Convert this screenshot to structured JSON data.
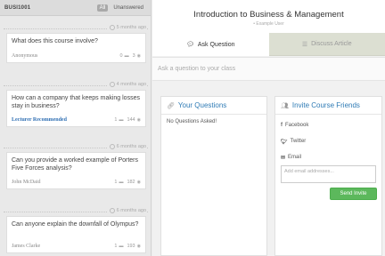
{
  "sidebar": {
    "course_code": "BUSI1001",
    "filters": {
      "all": "All",
      "unanswered": "Unanswered"
    },
    "questions": [
      {
        "time": "5 months ago",
        "text": "What does this course involve?",
        "author": "Anonymous",
        "answers": "0",
        "views": "3",
        "lecturer": false
      },
      {
        "time": "4 months ago",
        "text": "How can a company that keeps making losses stay in business?",
        "author": "Lecturer Recommended",
        "answers": "1",
        "views": "144",
        "lecturer": true
      },
      {
        "time": "6 months ago",
        "text": "Can you provide a worked example of Porters Five Forces analysis?",
        "author": "John McDaid",
        "answers": "1",
        "views": "182",
        "lecturer": false
      },
      {
        "time": "6 months ago",
        "text": "Can anyone explain the downfall of Olympus?",
        "author": "James Clarke",
        "answers": "1",
        "views": "193",
        "lecturer": false
      }
    ]
  },
  "main": {
    "title": "Introduction to Business & Management",
    "subtitle": "• Example User",
    "tabs": [
      {
        "label": "Ask Question",
        "active": true,
        "icon": "speech-bubble-icon"
      },
      {
        "label": "Discuss Article",
        "active": false,
        "icon": "article-icon"
      }
    ],
    "ask_placeholder": "Ask a question to your class"
  },
  "your_questions": {
    "heading": "Your Questions",
    "icon": "link-icon",
    "empty_text": "No Questions Asked!"
  },
  "invite": {
    "heading": "Invite Course Friends",
    "icon": "people-icon",
    "facebook": "Facebook",
    "twitter": "Twitter",
    "email": "Email",
    "email_placeholder": "Add email addresses...",
    "send_label": "Send Invite"
  },
  "colors": {
    "accent_blue": "#2f7bb5",
    "send_green": "#5cb85c",
    "inactive_tab": "#dcdfd2"
  }
}
